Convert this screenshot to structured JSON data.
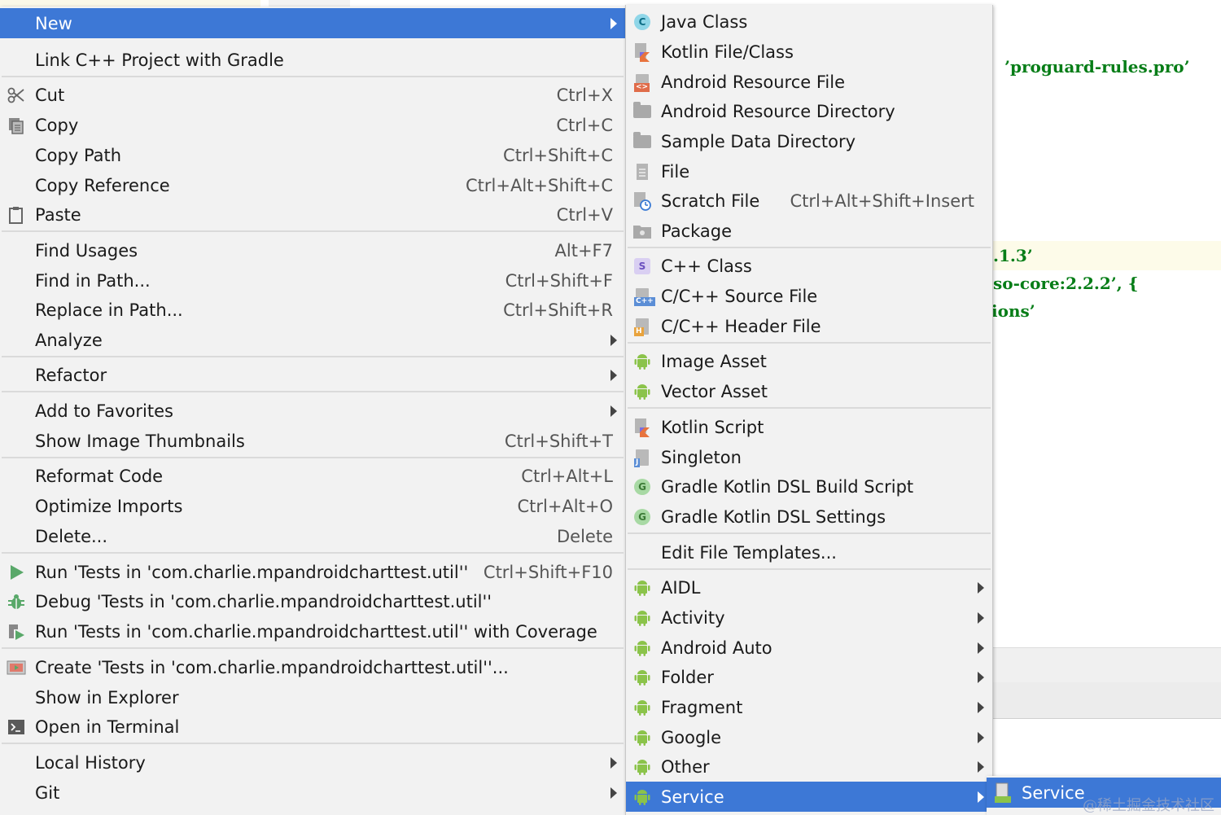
{
  "editor": {
    "lines": [
      "’proguard-rules.pro’",
      ".1.3’",
      "so-core:2.2.2’, {",
      "ions’"
    ]
  },
  "main_menu": {
    "items": [
      {
        "label": "New",
        "shortcut": "",
        "submenu": true,
        "selected": true,
        "icon": ""
      },
      {
        "label": "Link C++ Project with Gradle",
        "shortcut": "",
        "submenu": false,
        "icon": ""
      },
      {
        "label": "Cut",
        "shortcut": "Ctrl+X",
        "submenu": false,
        "icon": "scissors-icon"
      },
      {
        "label": "Copy",
        "shortcut": "Ctrl+C",
        "submenu": false,
        "icon": "copy-icon"
      },
      {
        "label": "Copy Path",
        "shortcut": "Ctrl+Shift+C",
        "submenu": false,
        "icon": ""
      },
      {
        "label": "Copy Reference",
        "shortcut": "Ctrl+Alt+Shift+C",
        "submenu": false,
        "icon": ""
      },
      {
        "label": "Paste",
        "shortcut": "Ctrl+V",
        "submenu": false,
        "icon": "clipboard-icon"
      },
      {
        "label": "Find Usages",
        "shortcut": "Alt+F7",
        "submenu": false,
        "icon": ""
      },
      {
        "label": "Find in Path...",
        "shortcut": "Ctrl+Shift+F",
        "submenu": false,
        "icon": ""
      },
      {
        "label": "Replace in Path...",
        "shortcut": "Ctrl+Shift+R",
        "submenu": false,
        "icon": ""
      },
      {
        "label": "Analyze",
        "shortcut": "",
        "submenu": true,
        "icon": ""
      },
      {
        "label": "Refactor",
        "shortcut": "",
        "submenu": true,
        "icon": ""
      },
      {
        "label": "Add to Favorites",
        "shortcut": "",
        "submenu": true,
        "icon": ""
      },
      {
        "label": "Show Image Thumbnails",
        "shortcut": "Ctrl+Shift+T",
        "submenu": false,
        "icon": ""
      },
      {
        "label": "Reformat Code",
        "shortcut": "Ctrl+Alt+L",
        "submenu": false,
        "icon": ""
      },
      {
        "label": "Optimize Imports",
        "shortcut": "Ctrl+Alt+O",
        "submenu": false,
        "icon": ""
      },
      {
        "label": "Delete...",
        "shortcut": "Delete",
        "submenu": false,
        "icon": ""
      },
      {
        "label": "Run 'Tests in 'com.charlie.mpandroidcharttest.util''",
        "shortcut": "Ctrl+Shift+F10",
        "submenu": false,
        "icon": "run-icon"
      },
      {
        "label": "Debug 'Tests in 'com.charlie.mpandroidcharttest.util''",
        "shortcut": "",
        "submenu": false,
        "icon": "debug-icon"
      },
      {
        "label": "Run 'Tests in 'com.charlie.mpandroidcharttest.util'' with Coverage",
        "shortcut": "",
        "submenu": false,
        "icon": "coverage-icon"
      },
      {
        "label": "Create 'Tests in 'com.charlie.mpandroidcharttest.util''...",
        "shortcut": "",
        "submenu": false,
        "icon": "create-test-icon"
      },
      {
        "label": "Show in Explorer",
        "shortcut": "",
        "submenu": false,
        "icon": ""
      },
      {
        "label": "Open in Terminal",
        "shortcut": "",
        "submenu": false,
        "icon": "terminal-icon"
      },
      {
        "label": "Local History",
        "shortcut": "",
        "submenu": true,
        "icon": ""
      },
      {
        "label": "Git",
        "shortcut": "",
        "submenu": true,
        "icon": ""
      }
    ]
  },
  "new_submenu": {
    "items": [
      {
        "label": "Java Class",
        "shortcut": "",
        "submenu": false,
        "icon": "java-class-icon"
      },
      {
        "label": "Kotlin File/Class",
        "shortcut": "",
        "submenu": false,
        "icon": "kotlin-file-icon"
      },
      {
        "label": "Android Resource File",
        "shortcut": "",
        "submenu": false,
        "icon": "android-resource-file-icon"
      },
      {
        "label": "Android Resource Directory",
        "shortcut": "",
        "submenu": false,
        "icon": "folder-icon"
      },
      {
        "label": "Sample Data Directory",
        "shortcut": "",
        "submenu": false,
        "icon": "folder-icon"
      },
      {
        "label": "File",
        "shortcut": "",
        "submenu": false,
        "icon": "file-icon"
      },
      {
        "label": "Scratch File",
        "shortcut": "Ctrl+Alt+Shift+Insert",
        "submenu": false,
        "icon": "scratch-file-icon"
      },
      {
        "label": "Package",
        "shortcut": "",
        "submenu": false,
        "icon": "package-icon"
      },
      {
        "label": "C++ Class",
        "shortcut": "",
        "submenu": false,
        "icon": "cpp-class-icon"
      },
      {
        "label": "C/C++ Source File",
        "shortcut": "",
        "submenu": false,
        "icon": "cpp-source-icon"
      },
      {
        "label": "C/C++ Header File",
        "shortcut": "",
        "submenu": false,
        "icon": "cpp-header-icon"
      },
      {
        "label": "Image Asset",
        "shortcut": "",
        "submenu": false,
        "icon": "android-icon"
      },
      {
        "label": "Vector Asset",
        "shortcut": "",
        "submenu": false,
        "icon": "android-icon"
      },
      {
        "label": "Kotlin Script",
        "shortcut": "",
        "submenu": false,
        "icon": "kotlin-script-icon"
      },
      {
        "label": "Singleton",
        "shortcut": "",
        "submenu": false,
        "icon": "singleton-icon"
      },
      {
        "label": "Gradle Kotlin DSL Build Script",
        "shortcut": "",
        "submenu": false,
        "icon": "gradle-icon"
      },
      {
        "label": "Gradle Kotlin DSL Settings",
        "shortcut": "",
        "submenu": false,
        "icon": "gradle-icon"
      },
      {
        "label": "Edit File Templates...",
        "shortcut": "",
        "submenu": false,
        "icon": ""
      },
      {
        "label": "AIDL",
        "shortcut": "",
        "submenu": true,
        "icon": "android-icon"
      },
      {
        "label": "Activity",
        "shortcut": "",
        "submenu": true,
        "icon": "android-icon"
      },
      {
        "label": "Android Auto",
        "shortcut": "",
        "submenu": true,
        "icon": "android-icon"
      },
      {
        "label": "Folder",
        "shortcut": "",
        "submenu": true,
        "icon": "android-icon"
      },
      {
        "label": "Fragment",
        "shortcut": "",
        "submenu": true,
        "icon": "android-icon"
      },
      {
        "label": "Google",
        "shortcut": "",
        "submenu": true,
        "icon": "android-icon"
      },
      {
        "label": "Other",
        "shortcut": "",
        "submenu": true,
        "icon": "android-icon"
      },
      {
        "label": "Service",
        "shortcut": "",
        "submenu": true,
        "selected": true,
        "icon": "android-icon"
      }
    ]
  },
  "service_submenu": {
    "items": [
      {
        "label": "Service",
        "icon": "service-file-icon",
        "selected": true
      }
    ]
  },
  "watermark": "@稀土掘金技术社区",
  "colors": {
    "selection": "#3d78d6",
    "menu_bg": "#f2f2f2",
    "code_string": "#067d17",
    "android_green": "#8bc34a"
  }
}
